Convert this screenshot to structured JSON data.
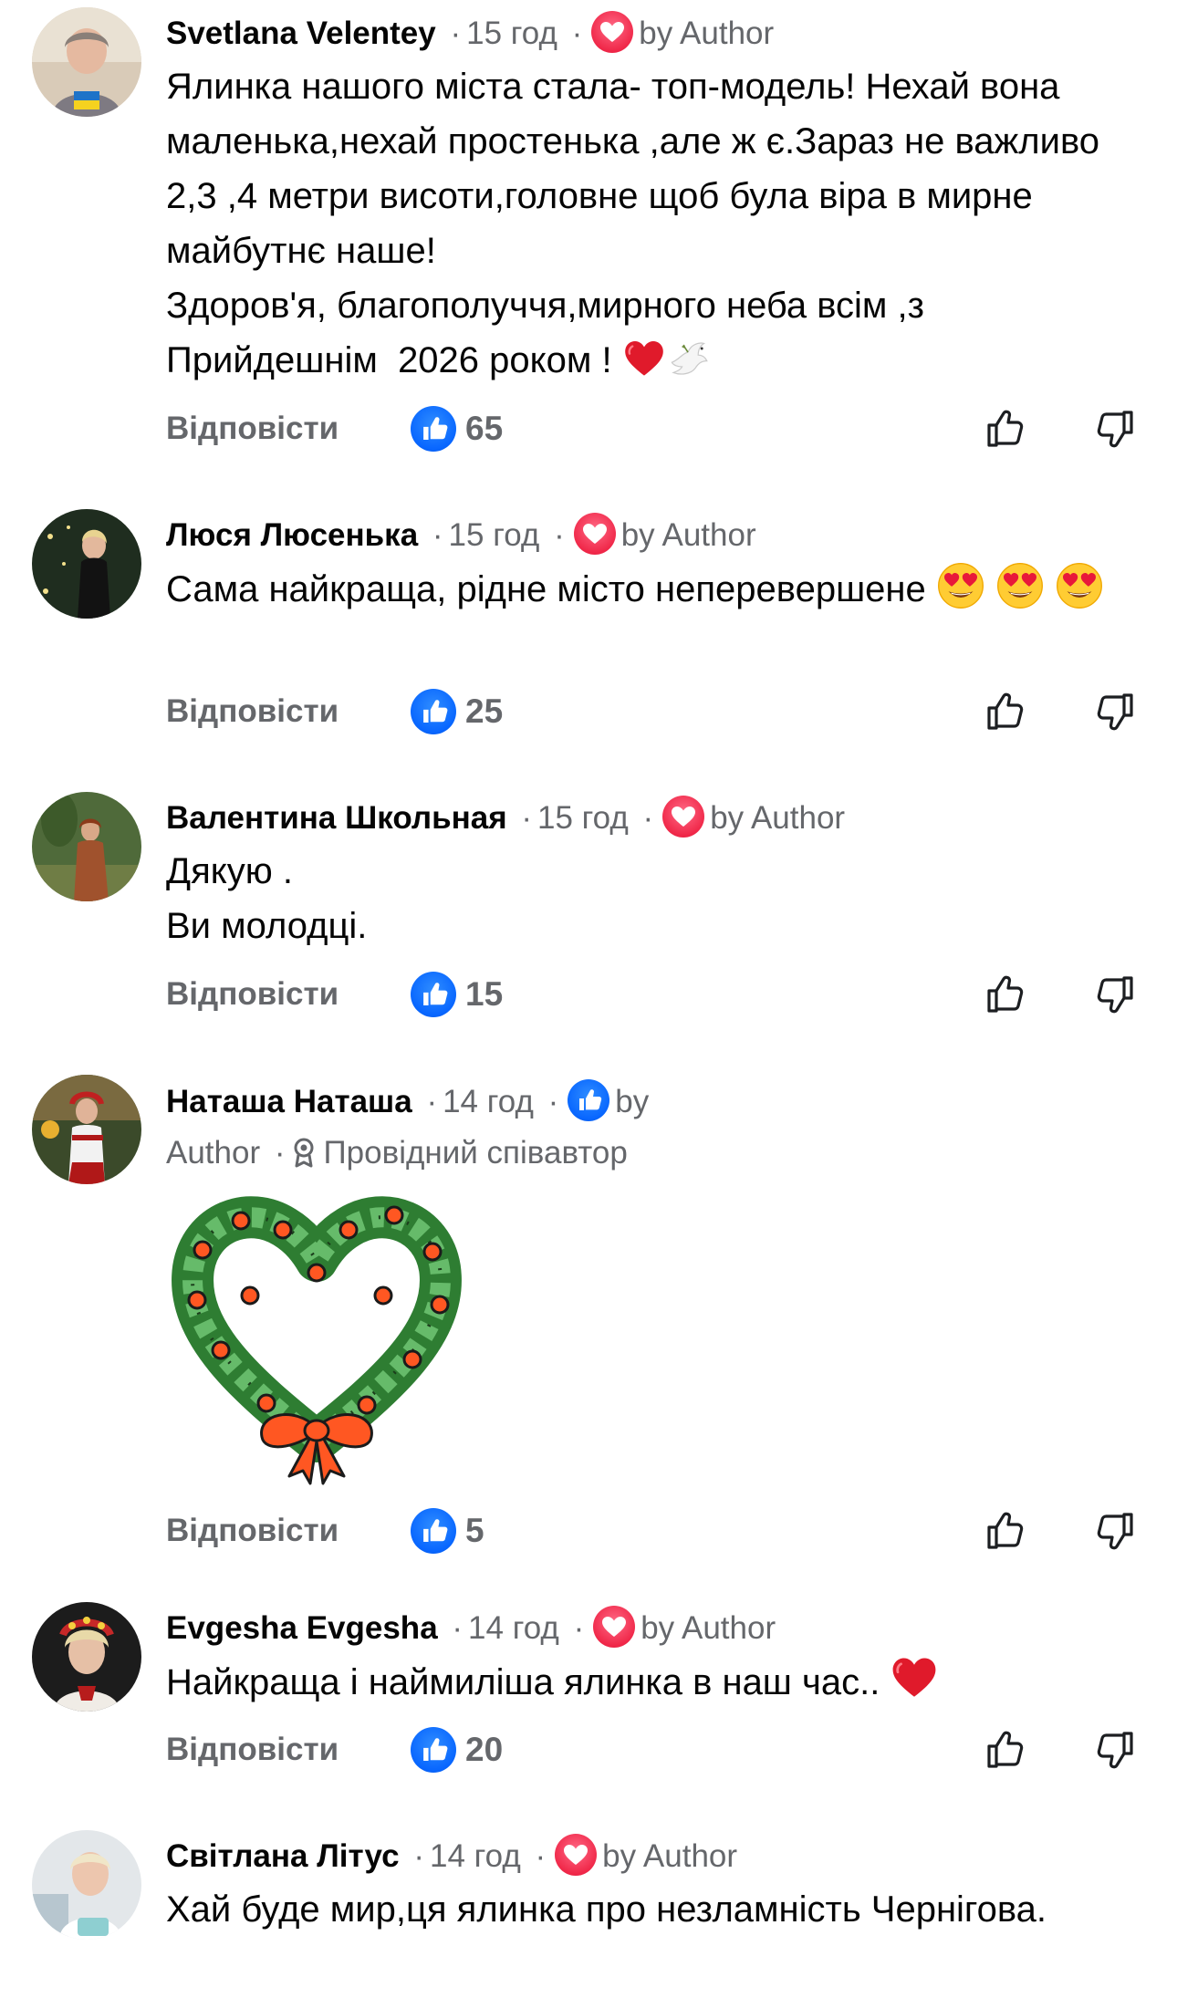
{
  "reply_label": "Відповісти",
  "dot": "·",
  "colors": {
    "love_badge": "#f02849",
    "like_badge": "#0866ff",
    "meta_gray": "#65676b"
  },
  "comments": [
    {
      "name": "Svetlana Velentey",
      "time": "15 год",
      "badge": "love",
      "by_author": "by Author",
      "text": "Ялинка нашого міста стала- топ-модель! Нехай вона маленька,нехай простенька ,але ж є.Зараз не важливо 2,3 ,4 метри висоти,головне щоб була віра в мирне майбутнє наше!\nЗдоров'я, благополуччя,мирного неба всім ,з Прийдешнім  2026 роком ! ",
      "emojis": [
        "red-heart",
        "dove"
      ],
      "likes": "65"
    },
    {
      "name": "Люся Люсенька",
      "time": "15 год",
      "badge": "love",
      "by_author": "by Author",
      "text": "Сама найкраща, рідне місто неперевершене ",
      "emojis": [
        "heart-eyes",
        "heart-eyes",
        "heart-eyes"
      ],
      "likes": "25"
    },
    {
      "name": "Валентина Школьная",
      "time": "15 год",
      "badge": "love",
      "by_author": "by Author",
      "text": "Дякую .\nВи молодці.",
      "likes": "15"
    },
    {
      "name": "Наташа Наташа",
      "time": "14 год",
      "badge": "like",
      "by_author_1": "by",
      "by_author_2": "Author",
      "role": "Провідний співавтор",
      "sticker": "heart-wreath",
      "likes": "5"
    },
    {
      "name": "Evgesha Evgesha",
      "time": "14 год",
      "badge": "love",
      "by_author": "by Author",
      "text": "Найкраща і наймиліша ялинка в наш час.. ",
      "emojis": [
        "red-heart"
      ],
      "likes": "20"
    },
    {
      "name": "Світлана Літус",
      "time": "14 год",
      "badge": "love",
      "by_author": "by Author",
      "text": "Хай буде мир,ця ялинка про незламність Чернігова."
    }
  ]
}
